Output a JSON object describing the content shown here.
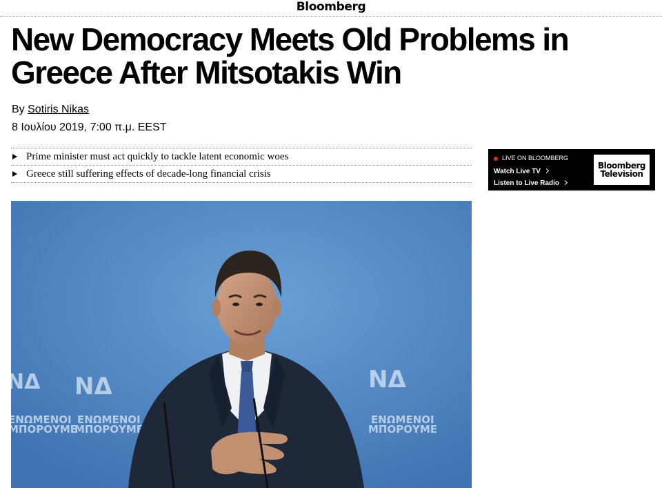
{
  "header": {
    "logo_text": "Bloomberg"
  },
  "article": {
    "headline": "New Democracy Meets Old Problems in Greece After Mitsotakis Win",
    "byline_prefix": "By",
    "author": "Sotiris Nikas",
    "date": "8 Ιουλίου 2019, 7:00 π.μ. EEST",
    "bullets": [
      "Prime minister must act quickly to tackle latent economic woes",
      "Greece still suffering effects of decade-long financial crisis"
    ]
  },
  "live_widget": {
    "label": "LIVE ON BLOOMBERG",
    "watch_link": "Watch Live TV",
    "radio_link": "Listen to Live Radio",
    "logo_line1": "Bloomberg",
    "logo_line2": "Television"
  },
  "photo": {
    "backdrop_logo_text": "ΝΔ",
    "backdrop_text_line1": "ΕΝΩΜΕΝΟΙ",
    "backdrop_text_line2": "ΜΠΟΡΟΥΜΕ",
    "colors": {
      "backdrop": "#4f86c4",
      "suit": "#1e2838",
      "tie": "#3a5a9a"
    }
  }
}
